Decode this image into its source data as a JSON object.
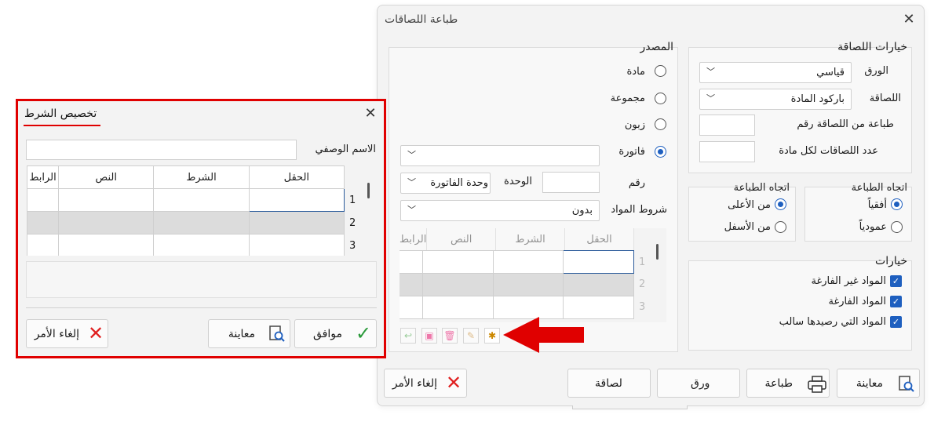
{
  "main_dialog": {
    "title": "طباعة اللصاقات",
    "label_options": {
      "group_title": "خيارات اللصاقة",
      "paper_label": "الورق",
      "paper_value": "قياسي",
      "label_label": "اللصاقة",
      "label_value": "باركود المادة",
      "print_from_label": "طباعة من اللصاقة رقم",
      "count_label": "عدد اللصاقات لكل مادة"
    },
    "print_direction_1": {
      "title": "اتجاه الطباعة",
      "horizontal": "أفقياً",
      "vertical": "عمودياً"
    },
    "print_direction_2": {
      "title": "اتجاه الطباعة",
      "from_top": "من الأعلى",
      "from_bottom": "من الأسفل"
    },
    "options": {
      "title": "خيارات",
      "non_empty": "المواد غير الفارغة",
      "empty": "المواد الفارغة",
      "negative": "المواد التي رصيدها سالب"
    },
    "source": {
      "title": "المصدر",
      "material": "مادة",
      "group": "مجموعة",
      "customer": "زبون",
      "invoice": "فاتورة",
      "number_label": "رقم",
      "unit_label": "الوحدة",
      "unit_value": "وحدة الفاتورة",
      "conditions_label": "شروط المواد",
      "conditions_value": "بدون",
      "grid_headers": [
        "الحقل",
        "الشرط",
        "النص",
        "الرابط"
      ],
      "row_numbers": [
        "1",
        "2",
        "3"
      ]
    },
    "buttons": {
      "preview": "معاينة",
      "print": "طباعة",
      "paper": "ورق",
      "label": "لصاقة",
      "cancel": "إلغاء الأمر"
    }
  },
  "cond_dialog": {
    "title": "تخصيص الشرط",
    "descriptive_name": "الاسم الوصفي",
    "grid_headers": [
      "الحقل",
      "الشرط",
      "النص",
      "الرابط"
    ],
    "row_numbers": [
      "1",
      "2",
      "3"
    ],
    "buttons": {
      "ok": "موافق",
      "preview": "معاينة",
      "cancel": "إلغاء الأمر"
    }
  },
  "colors": {
    "accent": "#1e5fbf",
    "highlight": "#e00000"
  }
}
